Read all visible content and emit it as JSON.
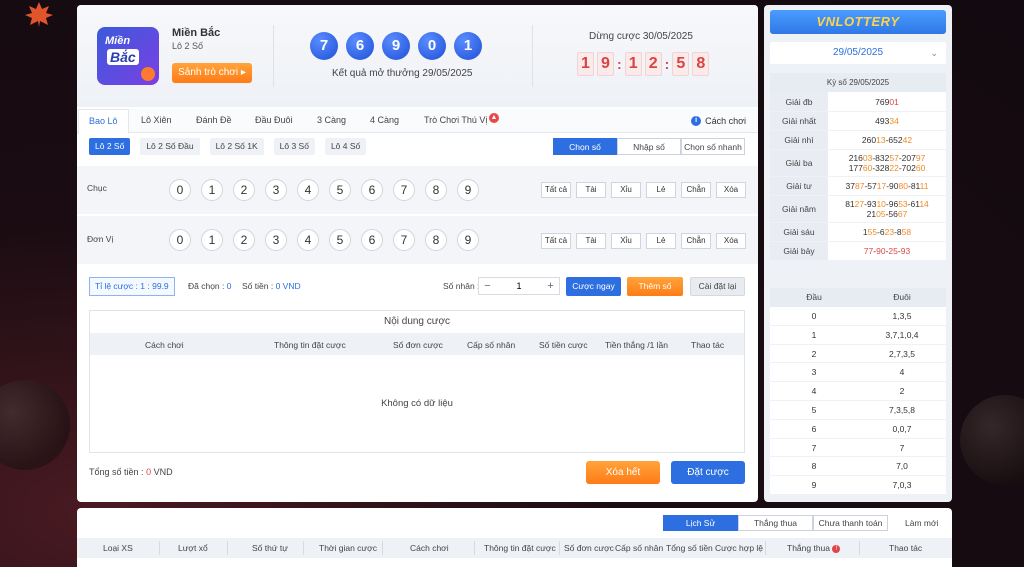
{
  "hero": {
    "icon_text_1": "Miền",
    "icon_text_2": "Bắc",
    "region": "Miền Bắc",
    "game": "Lô 2 Số",
    "lobby_button": "Sảnh trò chơi ▸",
    "result_balls": [
      "7",
      "6",
      "9",
      "0",
      "1"
    ],
    "result_caption": "Kết quả mở thưởng 29/05/2025",
    "stop_label": "Dừng cược 30/05/2025",
    "timer": [
      "1",
      "9",
      "1",
      "2",
      "5",
      "8"
    ]
  },
  "tabs": [
    "Bao Lô",
    "Lô Xiên",
    "Đánh Đề",
    "Đầu Đuôi",
    "3 Càng",
    "4 Càng",
    "Trò Chơi Thú Vị"
  ],
  "how_to": "Cách chơi",
  "subtabs": [
    "Lô 2 Số",
    "Lô 2 Số Đầu",
    "Lô 2 Số 1K",
    "Lô 3 Số",
    "Lô 4 Số"
  ],
  "modes": [
    "Chọn số",
    "Nhập số",
    "Chọn số nhanh"
  ],
  "rows": [
    {
      "label": "Chục"
    },
    {
      "label": "Đơn Vị"
    }
  ],
  "digits": [
    "0",
    "1",
    "2",
    "3",
    "4",
    "5",
    "6",
    "7",
    "8",
    "9"
  ],
  "quick_buttons": [
    "Tất cả",
    "Tài",
    "Xỉu",
    "Lẻ",
    "Chẵn",
    "Xóa"
  ],
  "controls": {
    "rate_label": "Tỉ lệ cược :",
    "rate_value": "1 : 99.9",
    "chosen_label": "Đã chọn :",
    "chosen_value": "0",
    "money_label": "Số tiền :",
    "money_value": "0 VND",
    "multiplier_label": "Số nhân :",
    "multiplier_value": "1",
    "quick_bet": "Cược ngay",
    "add_number": "Thêm số",
    "reset": "Cài đặt lại"
  },
  "bet_table": {
    "title": "Nội dung cược",
    "headers": [
      "Cách chơi",
      "Thông tin đặt cược",
      "Số đơn cược",
      "Cấp số nhân",
      "Số tiền cược",
      "Tiền thắng /1 lần",
      "Thao tác"
    ],
    "empty": "Không có dữ liệu"
  },
  "total": {
    "label": "Tổng số tiền :",
    "value": "0",
    "unit": "VND"
  },
  "actions": {
    "clear": "Xóa hết",
    "place": "Đặt cược"
  },
  "sidebar": {
    "logo": "VNLOTTERY",
    "date": "29/05/2025",
    "draw_header": "Kỳ số 29/05/2025",
    "prizes": [
      {
        "name": "Giải đb",
        "lines": [
          [
            "769",
            "01"
          ]
        ]
      },
      {
        "name": "Giải nhất",
        "lines": [
          [
            "493",
            "34"
          ]
        ]
      },
      {
        "name": "Giải nhì",
        "lines": [
          [
            "260",
            "13",
            "-652",
            "42"
          ]
        ]
      },
      {
        "name": "Giải ba",
        "lines": [
          [
            "216",
            "03",
            "-832",
            "57",
            "-207",
            "97"
          ],
          [
            "177",
            "60",
            "-328",
            "22",
            "-702",
            "60"
          ]
        ]
      },
      {
        "name": "Giải tư",
        "lines": [
          [
            "37",
            "87",
            "-57",
            "17",
            "-90",
            "80",
            "-81",
            "11"
          ]
        ]
      },
      {
        "name": "Giải năm",
        "lines": [
          [
            "81",
            "27",
            "-93",
            "10",
            "-96",
            "53",
            "-61",
            "14"
          ],
          [
            "21",
            "05",
            "-56",
            "67"
          ]
        ]
      },
      {
        "name": "Giải sáu",
        "lines": [
          [
            "1",
            "55",
            "-6",
            "23",
            "-8",
            "58"
          ]
        ]
      },
      {
        "name": "Giải bảy",
        "lines": [
          [
            "",
            "77",
            "-",
            "90",
            "-",
            "25",
            "-",
            "93"
          ]
        ]
      }
    ],
    "head_tail_headers": [
      "Đầu",
      "Đuôi"
    ],
    "head_tail": [
      [
        "0",
        "1,3,5"
      ],
      [
        "1",
        "3,7,1,0,4"
      ],
      [
        "2",
        "2,7,3,5"
      ],
      [
        "3",
        "4"
      ],
      [
        "4",
        "2"
      ],
      [
        "5",
        "7,3,5,8"
      ],
      [
        "6",
        "0,0,7"
      ],
      [
        "7",
        "7"
      ],
      [
        "8",
        "7,0"
      ],
      [
        "9",
        "7,0,3"
      ]
    ]
  },
  "history": {
    "tabs": [
      "Lịch Sử",
      "Thắng thua",
      "Chưa thanh toán"
    ],
    "refresh": "Làm mới",
    "headers": [
      "Loại XS",
      "Lượt xổ",
      "Số thứ tự",
      "Thời gian cược",
      "Cách chơi",
      "Thông tin đặt cược",
      "Số đơn cược",
      "Cấp số nhân",
      "Tổng số tiền",
      "Cược hợp lệ",
      "Thắng thua",
      "Thao tác"
    ]
  }
}
